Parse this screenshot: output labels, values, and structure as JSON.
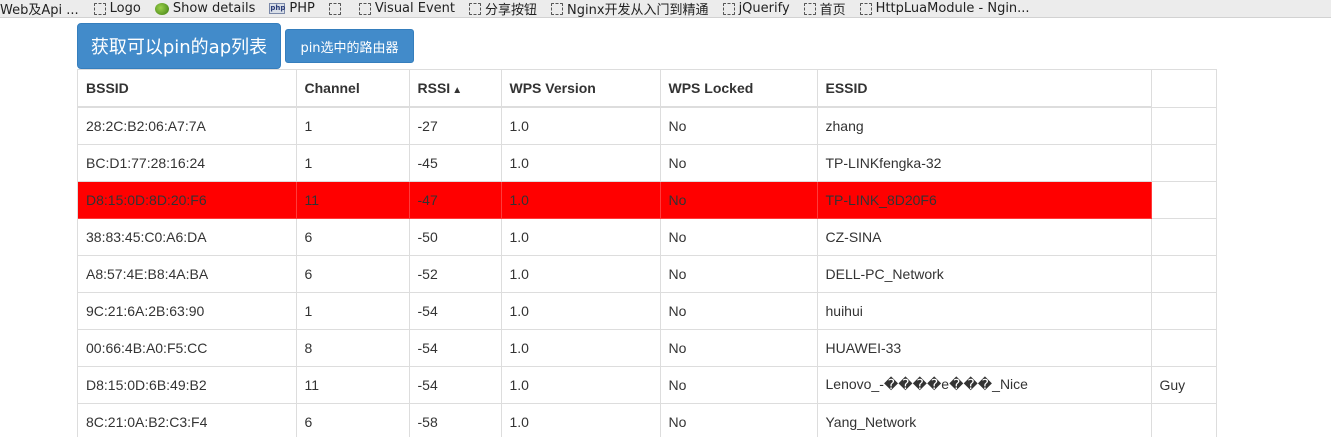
{
  "bookmarks": [
    {
      "label": "Web及Api ...",
      "icon": "none"
    },
    {
      "label": "Logo",
      "icon": "folder-icon"
    },
    {
      "label": "Show details",
      "icon": "bug-icon"
    },
    {
      "label": "PHP",
      "icon": "php-icon"
    },
    {
      "label": "",
      "icon": "folder-icon"
    },
    {
      "label": "Visual Event",
      "icon": "folder-icon"
    },
    {
      "label": "分享按钮",
      "icon": "folder-icon"
    },
    {
      "label": "Nginx开发从入门到精通",
      "icon": "folder-icon"
    },
    {
      "label": "jQuerify",
      "icon": "folder-icon"
    },
    {
      "label": "首页",
      "icon": "folder-icon"
    },
    {
      "label": "HttpLuaModule - Ngin...",
      "icon": "folder-icon"
    }
  ],
  "toolbar": {
    "fetch_button": "获取可以pin的ap列表",
    "pin_button": "pin选中的路由器"
  },
  "table": {
    "headers": [
      "BSSID",
      "Channel",
      "RSSI",
      "WPS Version",
      "WPS Locked",
      "ESSID",
      ""
    ],
    "sort_indicator": "▲",
    "highlight_color": "#ff0000",
    "rows": [
      [
        "28:2C:B2:06:A7:7A",
        "1",
        "-27",
        "1.0",
        "No",
        "zhang",
        ""
      ],
      [
        "BC:D1:77:28:16:24",
        "1",
        "-45",
        "1.0",
        "No",
        "TP-LINKfengka-32",
        ""
      ],
      [
        "D8:15:0D:8D:20:F6",
        "11",
        "-47",
        "1.0",
        "No",
        "TP-LINK_8D20F6",
        ""
      ],
      [
        "38:83:45:C0:A6:DA",
        "6",
        "-50",
        "1.0",
        "No",
        "CZ-SINA",
        ""
      ],
      [
        "A8:57:4E:B8:4A:BA",
        "6",
        "-52",
        "1.0",
        "No",
        "DELL-PC_Network",
        ""
      ],
      [
        "9C:21:6A:2B:63:90",
        "1",
        "-54",
        "1.0",
        "No",
        "huihui",
        ""
      ],
      [
        "00:66:4B:A0:F5:CC",
        "8",
        "-54",
        "1.0",
        "No",
        "HUAWEI-33",
        ""
      ],
      [
        "D8:15:0D:6B:49:B2",
        "11",
        "-54",
        "1.0",
        "No",
        "Lenovo_-����e���_Nice",
        "Guy"
      ],
      [
        "8C:21:0A:B2:C3:F4",
        "6",
        "-58",
        "1.0",
        "No",
        "Yang_Network",
        ""
      ]
    ],
    "selected_row": 2
  }
}
